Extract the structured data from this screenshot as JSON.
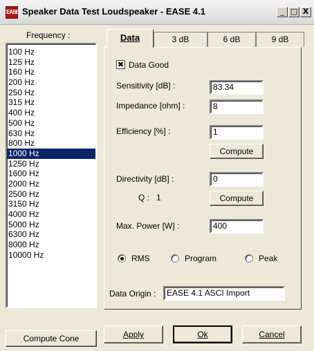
{
  "window": {
    "title": "Speaker Data Test Loudspeaker - EASE 4.1",
    "app_icon_text": "EASE",
    "minimize": "_",
    "maximize": "□",
    "close": "X"
  },
  "frequency": {
    "label": "Frequency :",
    "items": [
      "100 Hz",
      "125 Hz",
      "160 Hz",
      "200 Hz",
      "250 Hz",
      "315 Hz",
      "400 Hz",
      "500 Hz",
      "630 Hz",
      "800 Hz",
      "1000 Hz",
      "1250 Hz",
      "1600 Hz",
      "2000 Hz",
      "2500 Hz",
      "3150 Hz",
      "4000 Hz",
      "5000 Hz",
      "6300 Hz",
      "8000 Hz",
      "10000 Hz"
    ],
    "selected_index": 10
  },
  "tabs": [
    {
      "label": "Data",
      "active": true
    },
    {
      "label": "3 dB",
      "active": false
    },
    {
      "label": "6 dB",
      "active": false
    },
    {
      "label": "9 dB",
      "active": false
    }
  ],
  "data_tab": {
    "data_good_label": "Data Good",
    "data_good_checked": true,
    "sensitivity_label": "Sensitivity [dB] :",
    "sensitivity_value": "83.34",
    "impedance_label": "Impedance [ohm] :",
    "impedance_value": "8",
    "efficiency_label": "Efficiency [%] :",
    "efficiency_value": "1",
    "compute_label": "Compute",
    "directivity_label": "Directivity [dB] :",
    "directivity_value": "0",
    "q_label": "Q :",
    "q_value": "1",
    "max_power_label": "Max. Power [W] :",
    "max_power_value": "400",
    "power_modes": [
      {
        "label": "RMS",
        "selected": true
      },
      {
        "label": "Program",
        "selected": false
      },
      {
        "label": "Peak",
        "selected": false
      }
    ],
    "data_origin_label": "Data Origin :",
    "data_origin_value": "EASE 4.1 ASCI Import"
  },
  "footer": {
    "compute_cone": "Compute Cone",
    "apply": "Apply",
    "ok": "Ok",
    "cancel": "Cancel"
  }
}
